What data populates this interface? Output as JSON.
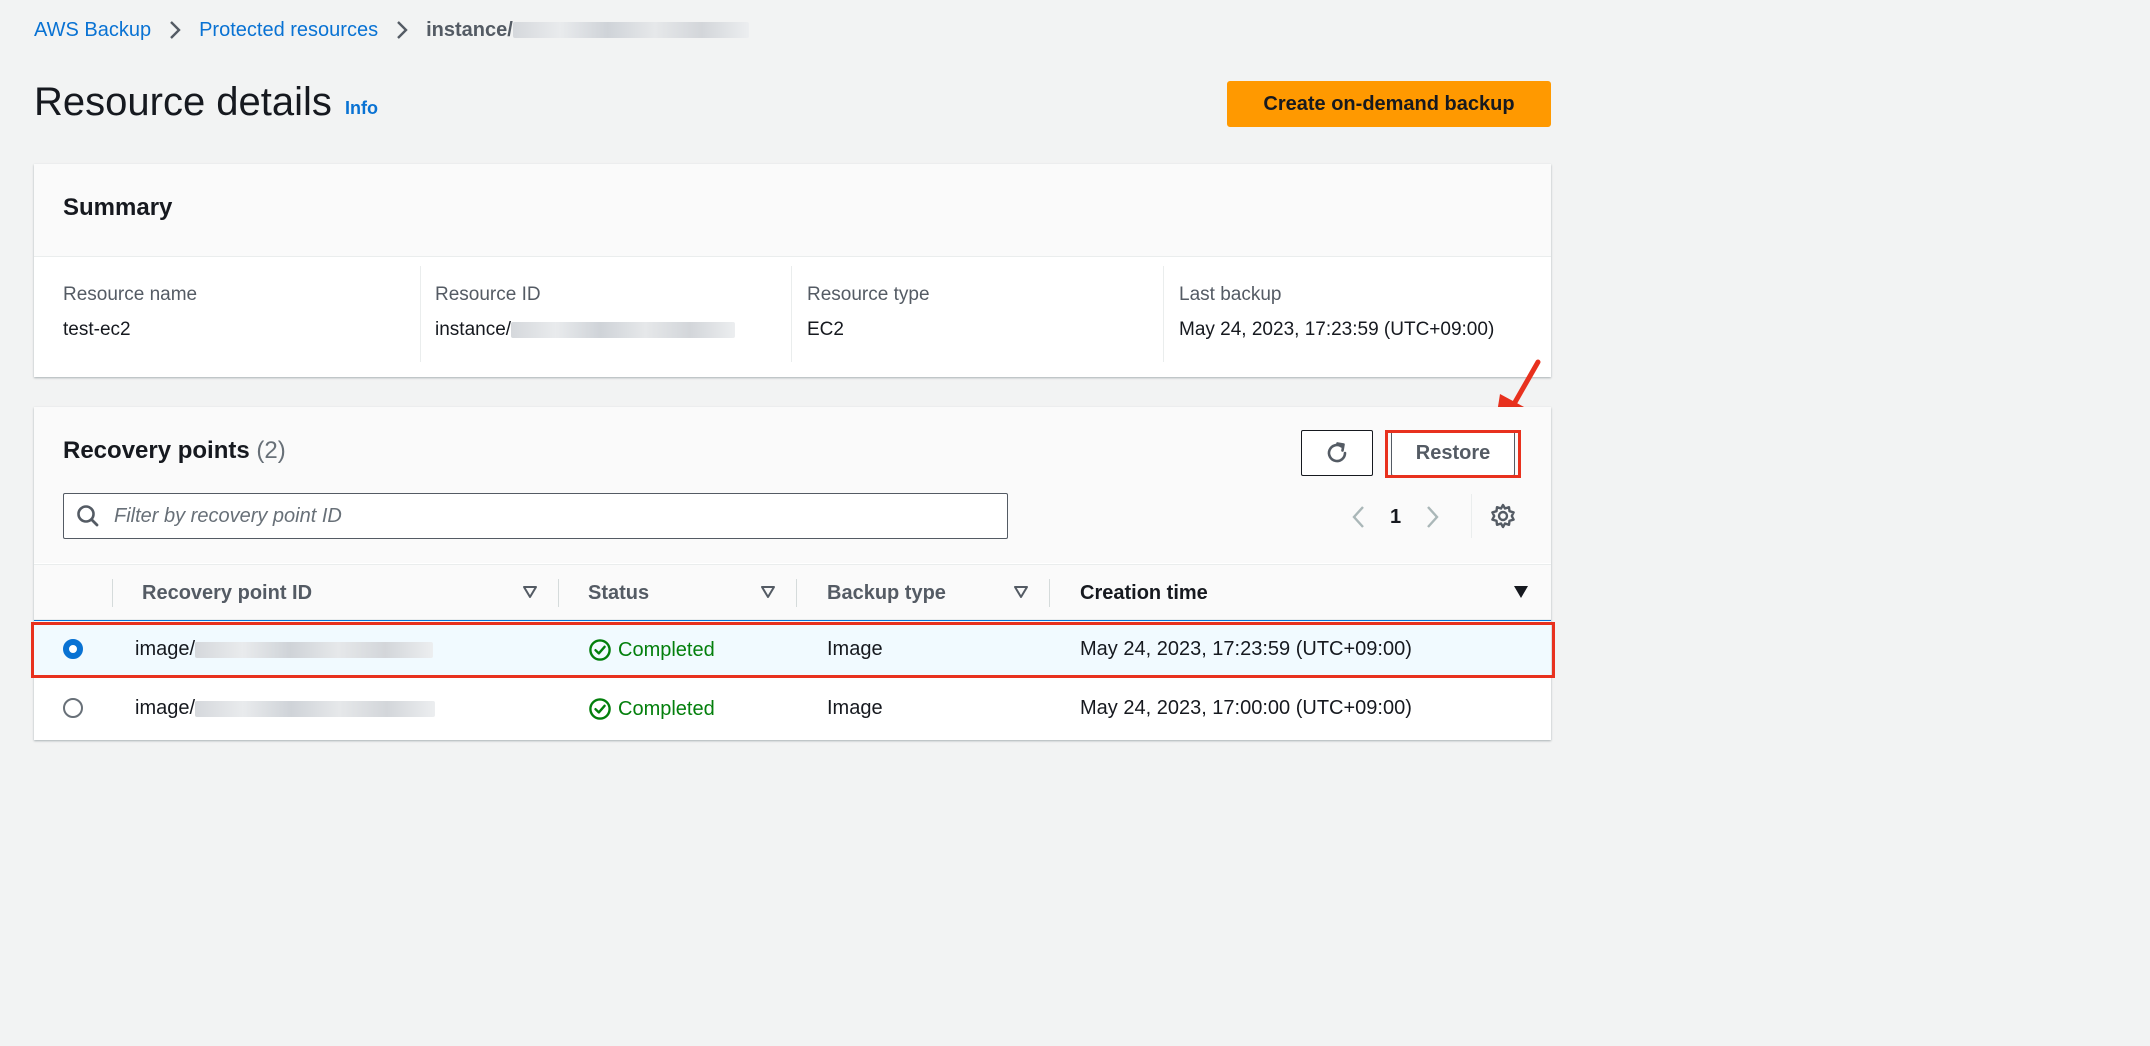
{
  "breadcrumb": {
    "items": [
      "AWS Backup",
      "Protected resources"
    ],
    "current": "instance/"
  },
  "page": {
    "title": "Resource details",
    "info_link": "Info",
    "create_backup_label": "Create on-demand backup"
  },
  "summary": {
    "title": "Summary",
    "fields": [
      {
        "label": "Resource name",
        "value": "test-ec2"
      },
      {
        "label": "Resource ID",
        "value": "instance/"
      },
      {
        "label": "Resource type",
        "value": "EC2"
      },
      {
        "label": "Last backup",
        "value": "May 24, 2023, 17:23:59 (UTC+09:00)"
      }
    ]
  },
  "recovery_points": {
    "title": "Recovery points",
    "count": "(2)",
    "restore_label": "Restore",
    "search_placeholder": "Filter by recovery point ID",
    "page_number": "1",
    "columns": [
      "Recovery point ID",
      "Status",
      "Backup type",
      "Creation time"
    ],
    "rows": [
      {
        "id": "image/",
        "status": "Completed",
        "backup_type": "Image",
        "creation_time": "May 24, 2023, 17:23:59 (UTC+09:00)",
        "selected": true
      },
      {
        "id": "image/",
        "status": "Completed",
        "backup_type": "Image",
        "creation_time": "May 24, 2023, 17:00:00 (UTC+09:00)",
        "selected": false
      }
    ]
  },
  "colors": {
    "link": "#0972d3",
    "primary_button": "#ff9900",
    "success": "#037f0c",
    "highlight_annotation": "#e8311e"
  },
  "icons": [
    "chevron-right-icon",
    "refresh-icon",
    "search-icon",
    "chevron-left-icon",
    "gear-icon",
    "sort-icon",
    "check-circle-icon",
    "annotation-arrow-icon"
  ]
}
